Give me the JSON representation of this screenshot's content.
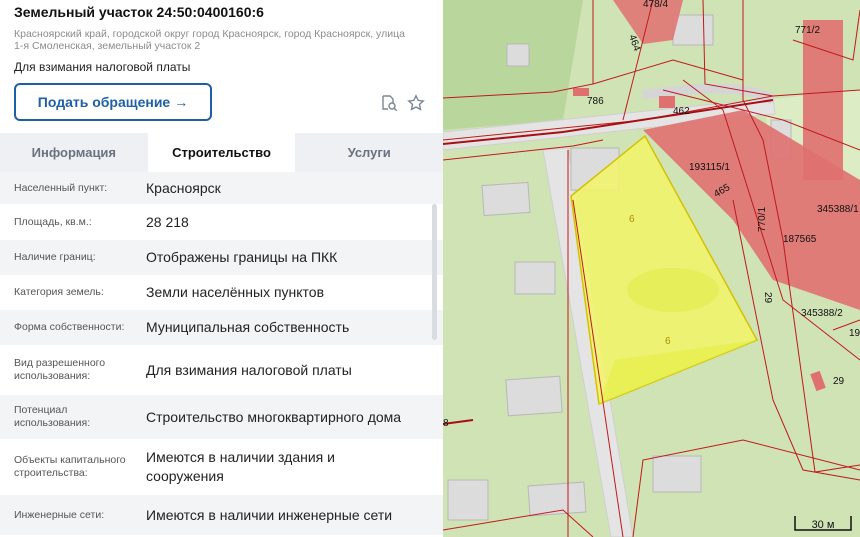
{
  "header": {
    "title": "Земельный участок 24:50:0400160:6",
    "address": "Красноярский край, городской округ город Красноярск, город Красноярск, улица 1-я Смоленская, земельный участок 2",
    "purpose": "Для взимания налоговой платы"
  },
  "actions": {
    "appeal_label": "Подать обращение",
    "appeal_arrow": "→"
  },
  "tabs": [
    {
      "label": "Информация",
      "active": false
    },
    {
      "label": "Строительство",
      "active": true
    },
    {
      "label": "Услуги",
      "active": false
    }
  ],
  "properties": [
    {
      "label": "Населенный пункт:",
      "value": "Красноярск"
    },
    {
      "label": "Площадь, кв.м.:",
      "value": "28 218"
    },
    {
      "label": "Наличие границ:",
      "value": "Отображены границы на ПКК"
    },
    {
      "label": "Категория земель:",
      "value": "Земли населённых пунктов"
    },
    {
      "label": "Форма собственности:",
      "value": "Муниципальная собственность"
    },
    {
      "label": "Вид разрешенного использования:",
      "value": "Для взимания налоговой платы"
    },
    {
      "label": "Потенциал использования:",
      "value": "Строительство многоквартирного дома"
    },
    {
      "label": "Объекты капитального строительства:",
      "value": "Имеются в наличии здания и сооружения"
    },
    {
      "label": "Инженерные сети:",
      "value": "Имеются в наличии инженерные сети"
    }
  ],
  "map": {
    "labels": [
      "478/4",
      "464",
      "771/2",
      "786",
      "462",
      "193115/1",
      "465",
      "6",
      "6",
      "770/1",
      "345388/1",
      "187565",
      "29",
      "345388/2",
      "19",
      "29",
      "8"
    ],
    "scale_label": "30 м",
    "colors": {
      "parcel_fill": "#f2f566",
      "parcel_stroke": "#d4c200",
      "boundary": "#c0191c",
      "zone_fill": "#e07070",
      "grass": "#cfe3b4",
      "road": "#e4e4e4"
    }
  }
}
